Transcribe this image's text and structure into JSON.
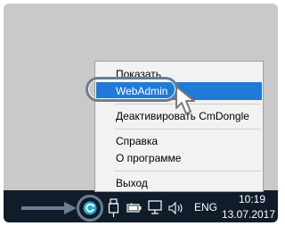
{
  "menu": {
    "items": [
      {
        "label": "Показать"
      },
      {
        "label": "WebAdmin"
      },
      {
        "label": "Деактивировать CmDongle"
      },
      {
        "label": "Справка"
      },
      {
        "label": "О программе"
      },
      {
        "label": "Выход"
      }
    ],
    "highlighted": "WebAdmin"
  },
  "taskbar": {
    "tray_icons": [
      "codemeter-icon",
      "usb-device-icon",
      "battery-icon",
      "network-icon",
      "volume-icon"
    ],
    "language": "ENG",
    "time": "10:19",
    "date": "13.07.2017"
  },
  "colors": {
    "desktop": "#c9c9c9",
    "taskbar": "#101c2a",
    "menu_background": "#f2f2f2",
    "menu_selection": "#1f7ad8",
    "annotation": "#6b7d8f"
  }
}
